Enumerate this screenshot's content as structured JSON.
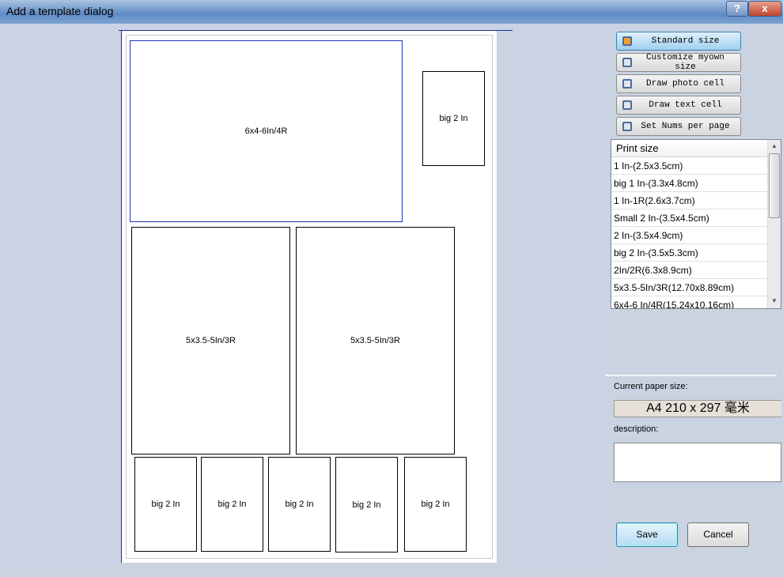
{
  "window": {
    "title": "Add a template dialog",
    "help_label": "?",
    "close_label": "x"
  },
  "canvas": {
    "cells": [
      {
        "label": "6x4-6In/4R",
        "selected": true
      },
      {
        "label": "big 2 In"
      },
      {
        "label": "5x3.5-5In/3R"
      },
      {
        "label": "5x3.5-5In/3R"
      },
      {
        "label": "big 2 In"
      },
      {
        "label": "big 2 In"
      },
      {
        "label": "big 2 In"
      },
      {
        "label": "big 2 In"
      },
      {
        "label": "big 2 In"
      }
    ]
  },
  "modes": [
    {
      "label": "Standard size",
      "active": true
    },
    {
      "label": "Customize myown size"
    },
    {
      "label": "Draw photo cell"
    },
    {
      "label": "Draw text cell"
    },
    {
      "label": "Set Nums per page"
    }
  ],
  "print_size": {
    "header": "Print size",
    "items": [
      "1 In-(2.5x3.5cm)",
      "big 1 In-(3.3x4.8cm)",
      "1 In-1R(2.6x3.7cm)",
      "Small 2 In-(3.5x4.5cm)",
      "2 In-(3.5x4.9cm)",
      "big 2 In-(3.5x5.3cm)",
      "2In/2R(6.3x8.9cm)",
      "5x3.5-5In/3R(12.70x8.89cm)",
      "6x4-6 In/4R(15.24x10.16cm)"
    ]
  },
  "paper": {
    "label": "Current paper size:",
    "value": "A4 210 x 297 毫米"
  },
  "description": {
    "label": "description:",
    "value": ""
  },
  "buttons": {
    "save": "Save",
    "cancel": "Cancel"
  },
  "colors": {
    "selected_cell": "#2030c0",
    "accent": "#3c7fb1"
  }
}
